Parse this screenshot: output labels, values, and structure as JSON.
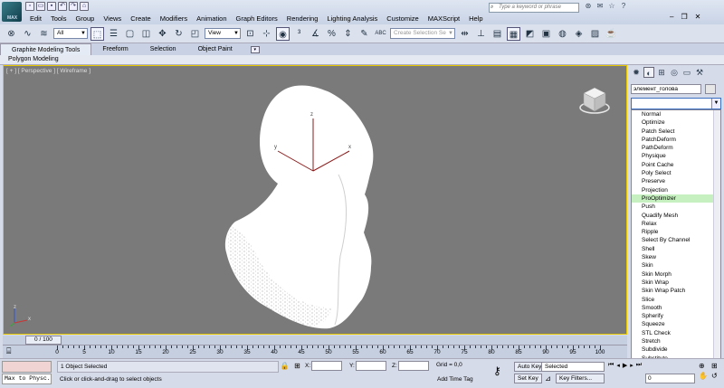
{
  "app": {
    "logo_text": "MAX"
  },
  "menu": [
    "Edit",
    "Tools",
    "Group",
    "Views",
    "Create",
    "Modifiers",
    "Animation",
    "Graph Editors",
    "Rendering",
    "Lighting Analysis",
    "Customize",
    "MAXScript",
    "Help"
  ],
  "search": {
    "placeholder": "Type a keyword or phrase"
  },
  "toolbar": {
    "filter_value": "All",
    "refcoord_value": "View",
    "percent_label": "%",
    "abc_label": "ABC",
    "selection_set_placeholder": "Create Selection Se"
  },
  "ribbon": {
    "tabs": [
      "Graphite Modeling Tools",
      "Freeform",
      "Selection",
      "Object Paint"
    ],
    "panel_label": "Polygon Modeling"
  },
  "viewport": {
    "label": "[ + ] [ Perspective ] [ Wireframe ]",
    "axis_x": "x",
    "axis_y": "y",
    "axis_z": "z",
    "tripod_z": "z",
    "tripod_x": "x"
  },
  "command_panel": {
    "object_name": "элемент_голова",
    "modifier_list": [
      "Normal",
      "Optimize",
      "Patch Select",
      "PatchDeform",
      "PathDeform",
      "Physique",
      "Point Cache",
      "Poly Select",
      "Preserve",
      "Projection",
      "ProOptimizer",
      "Push",
      "Quadify Mesh",
      "Relax",
      "Ripple",
      "Select By Channel",
      "Shell",
      "Skew",
      "Skin",
      "Skin Morph",
      "Skin Wrap",
      "Skin Wrap Patch",
      "Slice",
      "Smooth",
      "Spherify",
      "Squeeze",
      "STL Check",
      "Stretch",
      "Subdivide",
      "Substitute",
      "SurfDeform"
    ],
    "highlighted_modifier": "ProOptimizer",
    "highlight_color": "#c6f0c0"
  },
  "timeline": {
    "slider_text": "0 / 100",
    "ruler_labels": [
      "0",
      "5",
      "10",
      "15",
      "20",
      "25",
      "30",
      "35",
      "40",
      "45",
      "50",
      "55",
      "60",
      "65",
      "70",
      "75",
      "80",
      "85",
      "90",
      "95",
      "100"
    ]
  },
  "status": {
    "maxscript_text": "Max to Physc.",
    "selection_info": "1 Object Selected",
    "prompt": "Click or click-and-drag to select objects",
    "x_label": "X:",
    "y_label": "Y:",
    "z_label": "Z:",
    "grid": "Grid = 0,0",
    "add_time_tag": "Add Time Tag",
    "auto_key": "Auto Key",
    "set_key": "Set Key",
    "key_mode": "Selected",
    "key_filters": "Key Filters...",
    "frame_value": "0"
  }
}
